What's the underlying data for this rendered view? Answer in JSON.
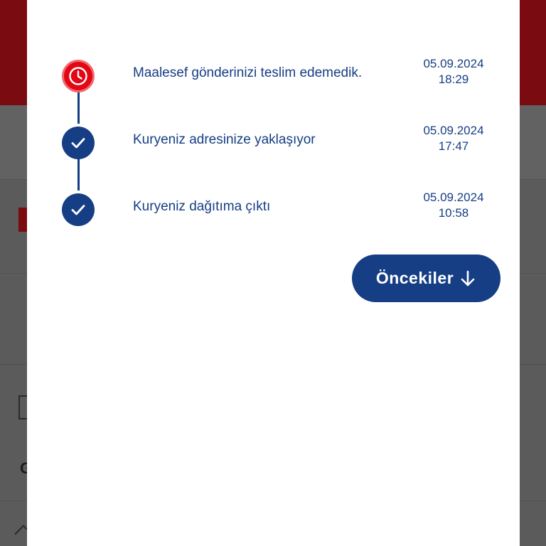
{
  "timeline": {
    "items": [
      {
        "status": "failed",
        "icon": "clock-icon",
        "text": "Maalesef gönderinizi teslim edemedik.",
        "date": "05.09.2024",
        "time": "18:29"
      },
      {
        "status": "done",
        "icon": "checkmark-icon",
        "text": "Kuryeniz adresinize yaklaşıyor",
        "date": "05.09.2024",
        "time": "17:47"
      },
      {
        "status": "done",
        "icon": "checkmark-icon",
        "text": "Kuryeniz dağıtıma çıktı",
        "date": "05.09.2024",
        "time": "10:58"
      }
    ]
  },
  "previous_button": {
    "label": "Öncekiler",
    "icon": "arrow-down-icon"
  },
  "colors": {
    "brand_blue": "#163e84",
    "alert_red": "#e30613",
    "overlay": "#5b5b5b"
  }
}
